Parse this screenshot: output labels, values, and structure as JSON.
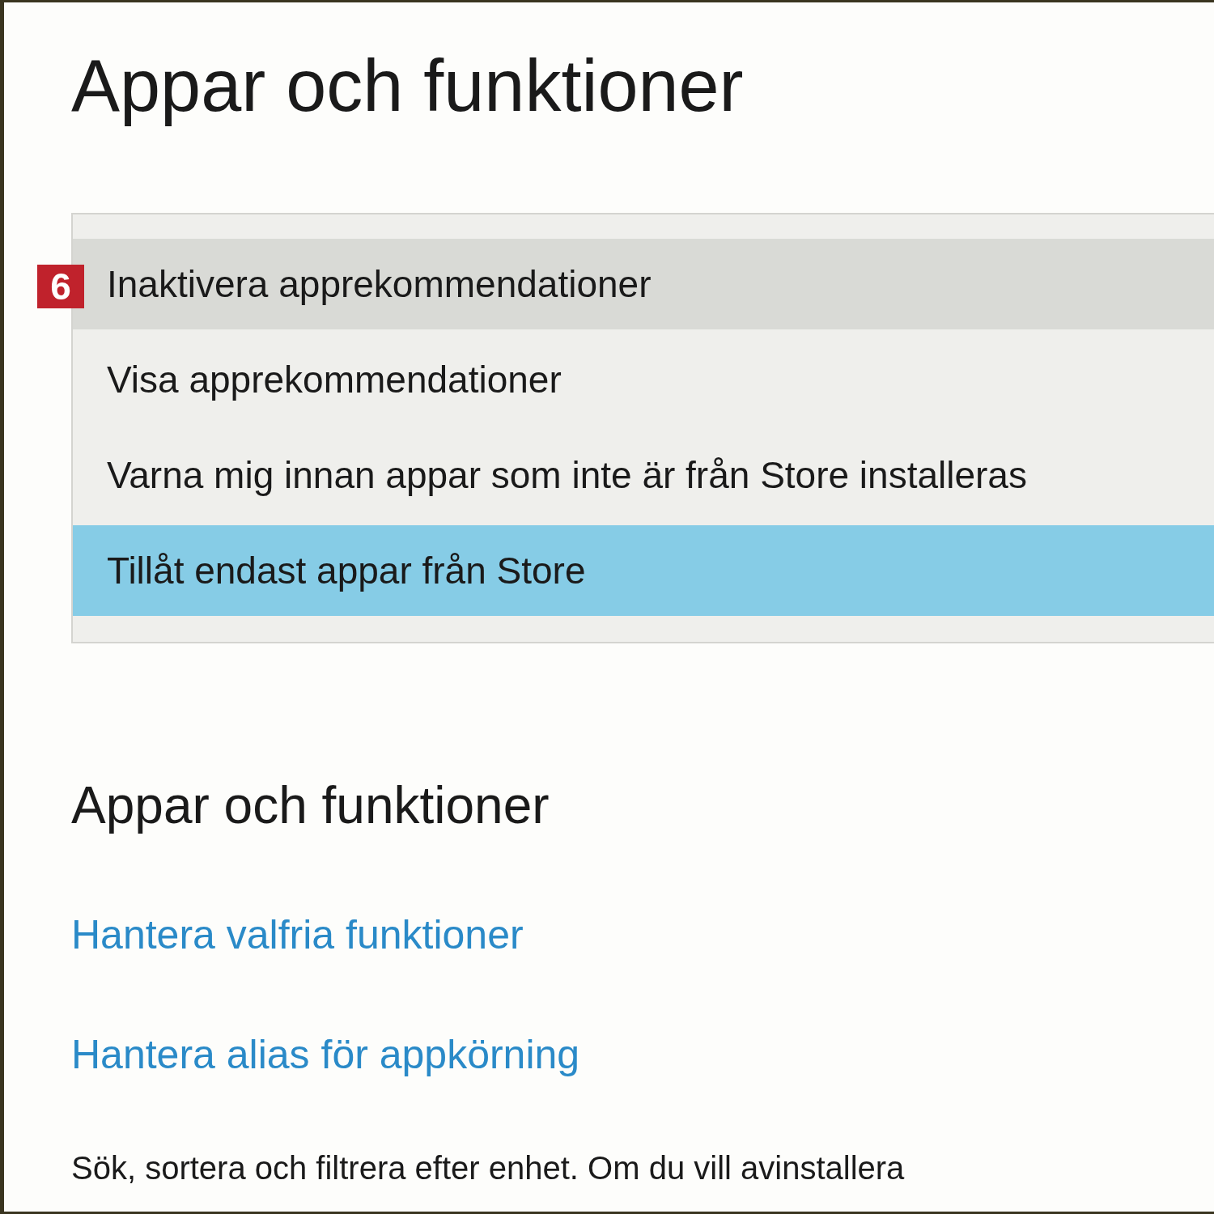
{
  "page": {
    "title": "Appar och funktioner"
  },
  "dropdown": {
    "badge": "6",
    "options": [
      {
        "label": "Inaktivera apprekommendationer",
        "selected": false,
        "hovered": true
      },
      {
        "label": "Visa apprekommendationer",
        "selected": false,
        "hovered": false
      },
      {
        "label": "Varna mig innan appar som inte är från Store installeras",
        "selected": false,
        "hovered": false
      },
      {
        "label": "Tillåt endast appar från Store",
        "selected": true,
        "hovered": false
      }
    ]
  },
  "section": {
    "title": "Appar och funktioner",
    "links": [
      "Hantera valfria funktioner",
      "Hantera alias för appkörning"
    ],
    "description": "Sök, sortera och filtrera efter enhet. Om du vill avinstallera"
  }
}
